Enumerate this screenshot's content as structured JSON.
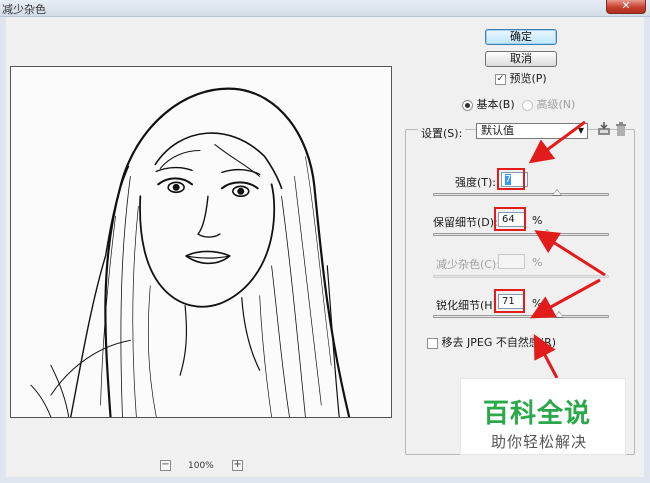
{
  "window": {
    "title": "减少杂色",
    "close_label": "✕"
  },
  "buttons": {
    "ok": "确定",
    "cancel": "取消"
  },
  "preview_option": {
    "label": "预览(P)",
    "checked": true
  },
  "mode": {
    "basic": "基本(B)",
    "advanced": "高级(N)",
    "selected": "basic"
  },
  "settings": {
    "label": "设置(S):",
    "value": "默认值"
  },
  "controls": {
    "strength": {
      "label": "强度(T):",
      "value": "7",
      "unit": "",
      "fraction": 0.7
    },
    "preserve": {
      "label": "保留细节(D):",
      "value": "64",
      "unit": "%",
      "fraction": 0.64
    },
    "reduce_color": {
      "label": "减少杂色(C):",
      "value": "",
      "unit": "%",
      "disabled": true
    },
    "sharpen": {
      "label": "锐化细节(H):",
      "value": "71",
      "unit": "%",
      "fraction": 0.71
    }
  },
  "jpeg": {
    "label": "移去 JPEG 不自然感(R)",
    "checked": false
  },
  "zoom": {
    "minus": "−",
    "plus": "+",
    "value": "100%"
  },
  "watermark": {
    "title": "百科全说",
    "subtitle": "助你轻松解决"
  },
  "icons": [
    "save-preset-icon",
    "trash-icon",
    "dropdown-arrow-icon"
  ],
  "colors": {
    "annotation": "#e21b1b",
    "watermark_green": "#2aa84a"
  }
}
